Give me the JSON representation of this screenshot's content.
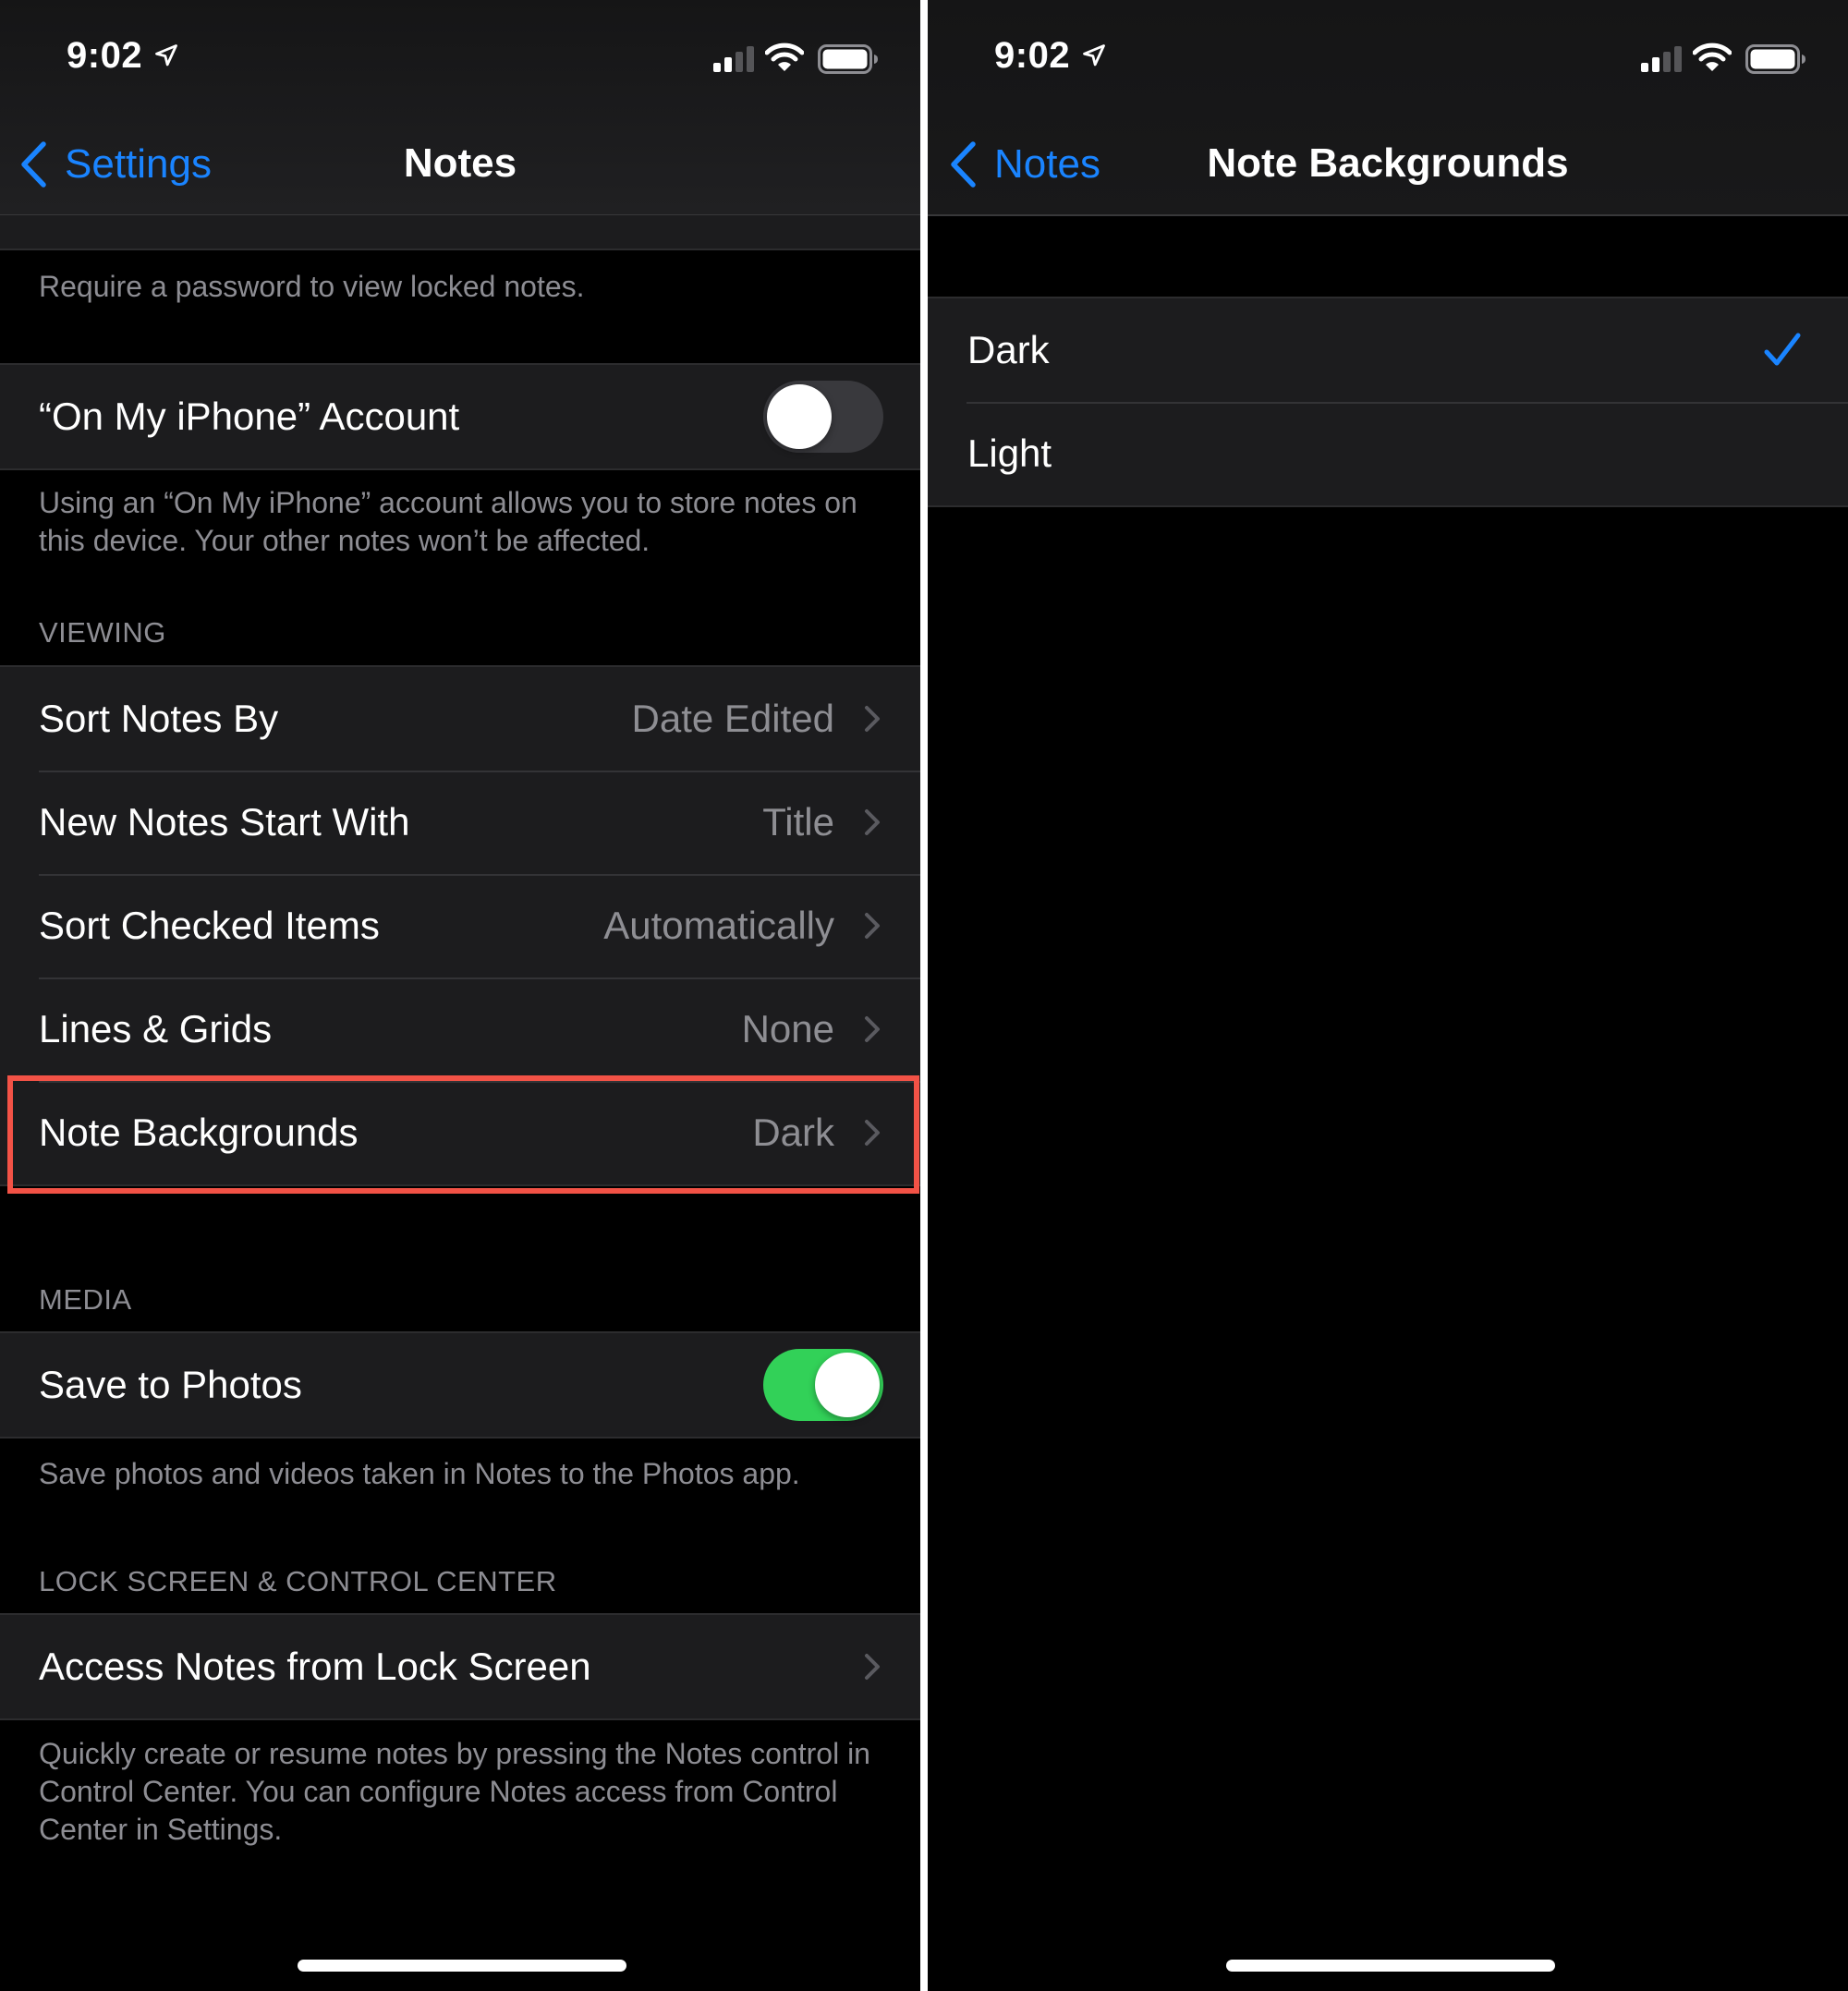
{
  "colors": {
    "accent_blue": "#1a84ff",
    "toggle_on_green": "#32d158",
    "highlight_red": "#f25246",
    "secondary_text": "#8e8e93"
  },
  "status_bar": {
    "time": "9:02",
    "location_icon": "location-arrow-icon",
    "signal_bars_filled": 2,
    "signal_bars_total": 4,
    "wifi_icon": "wifi-icon",
    "battery_icon": "battery-full-icon"
  },
  "left_screen": {
    "nav": {
      "back_label": "Settings",
      "title": "Notes"
    },
    "password_footer": "Require a password to view locked notes.",
    "on_my_iphone": {
      "label": "“On My iPhone” Account",
      "toggle_on": false,
      "footer": "Using an “On My iPhone” account allows you to store notes on this device. Your other notes won’t be affected."
    },
    "viewing": {
      "header": "VIEWING",
      "rows": [
        {
          "label": "Sort Notes By",
          "value": "Date Edited"
        },
        {
          "label": "New Notes Start With",
          "value": "Title"
        },
        {
          "label": "Sort Checked Items",
          "value": "Automatically"
        },
        {
          "label": "Lines & Grids",
          "value": "None"
        },
        {
          "label": "Note Backgrounds",
          "value": "Dark",
          "highlighted": true
        }
      ]
    },
    "media": {
      "header": "MEDIA",
      "save_to_photos": {
        "label": "Save to Photos",
        "toggle_on": true
      },
      "footer": "Save photos and videos taken in Notes to the Photos app."
    },
    "lock_screen": {
      "header": "LOCK SCREEN & CONTROL CENTER",
      "access_row": {
        "label": "Access Notes from Lock Screen"
      },
      "footer": "Quickly create or resume notes by pressing the Notes control in Control Center. You can configure Notes access from Control Center in Settings."
    }
  },
  "right_screen": {
    "nav": {
      "back_label": "Notes",
      "title": "Note Backgrounds"
    },
    "options": [
      {
        "label": "Dark",
        "selected": true
      },
      {
        "label": "Light",
        "selected": false
      }
    ]
  }
}
